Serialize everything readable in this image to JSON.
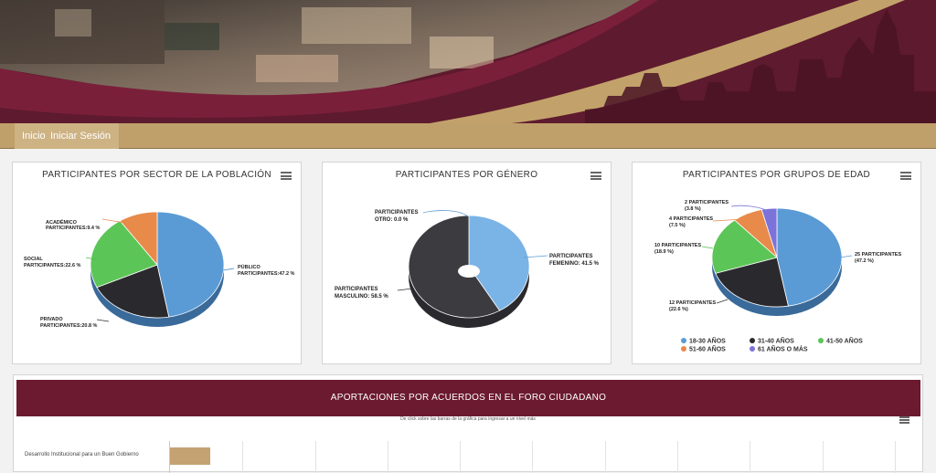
{
  "nav": {
    "inicio": "Inicio",
    "iniciar_sesion": "Iniciar Sesión"
  },
  "colors": {
    "maroon": "#6b1a2f",
    "gold": "#bfa06b",
    "blue": "#5b9bd5",
    "black": "#2a2a2e",
    "green": "#5cc557",
    "orange": "#e88a4a",
    "purple": "#7b73d9"
  },
  "chart_data": [
    {
      "type": "pie",
      "title": "PARTICIPANTES POR SECTOR DE LA POBLACIÓN",
      "slices": [
        {
          "line1": "PÚBLICO",
          "line2": "PARTICIPANTES:47.2 %",
          "value": 47.2
        },
        {
          "line1": "PRIVADO",
          "line2": "PARTICIPANTES:20.8 %",
          "value": 20.8
        },
        {
          "line1": "SOCIAL",
          "line2": "PARTICIPANTES:22.6 %",
          "value": 22.6
        },
        {
          "line1": "ACADÉMICO",
          "line2": "PARTICIPANTES:9.4 %",
          "value": 9.4
        }
      ]
    },
    {
      "type": "pie",
      "title": "PARTICIPANTES POR GÉNERO",
      "slices": [
        {
          "line1": "PARTICIPANTES",
          "line2": "FEMENINO: 41.5 %",
          "value": 41.5
        },
        {
          "line1": "PARTICIPANTES",
          "line2": "MASCULINO: 58.5 %",
          "value": 58.5
        },
        {
          "line1": "PARTICIPANTES",
          "line2": "OTRO: 0.0 %",
          "value": 0.0
        }
      ]
    },
    {
      "type": "pie",
      "title": "PARTICIPANTES POR GRUPOS DE EDAD",
      "slices": [
        {
          "line1": "25 PARTICIPANTES",
          "line2": "(47.2 %)",
          "value": 47.2
        },
        {
          "line1": "12 PARTICIPANTES",
          "line2": "(22.6 %)",
          "value": 22.6
        },
        {
          "line1": "10 PARTICIPANTES",
          "line2": "(18.9 %)",
          "value": 18.9
        },
        {
          "line1": "4 PARTICIPANTES",
          "line2": "(7.5 %)",
          "value": 7.5
        },
        {
          "line1": "2 PARTICIPANTES",
          "line2": "(3.8 %)",
          "value": 3.8
        }
      ],
      "legend": [
        "18-30 AÑOS",
        "31-40 AÑOS",
        "41-50 AÑOS",
        "51-60 AÑOS",
        "61 AÑOS O MÁS"
      ]
    },
    {
      "type": "bar",
      "title": "APORTACIONES POR ACUERDOS EN EL FORO CIUDADANO",
      "subtitle": "De click sobre las barras de la gráfica para ingresar a un nivel más",
      "categories": [
        "Desarrollo Institucional para un Buen Gobierno"
      ],
      "values": [
        0.55
      ]
    }
  ]
}
